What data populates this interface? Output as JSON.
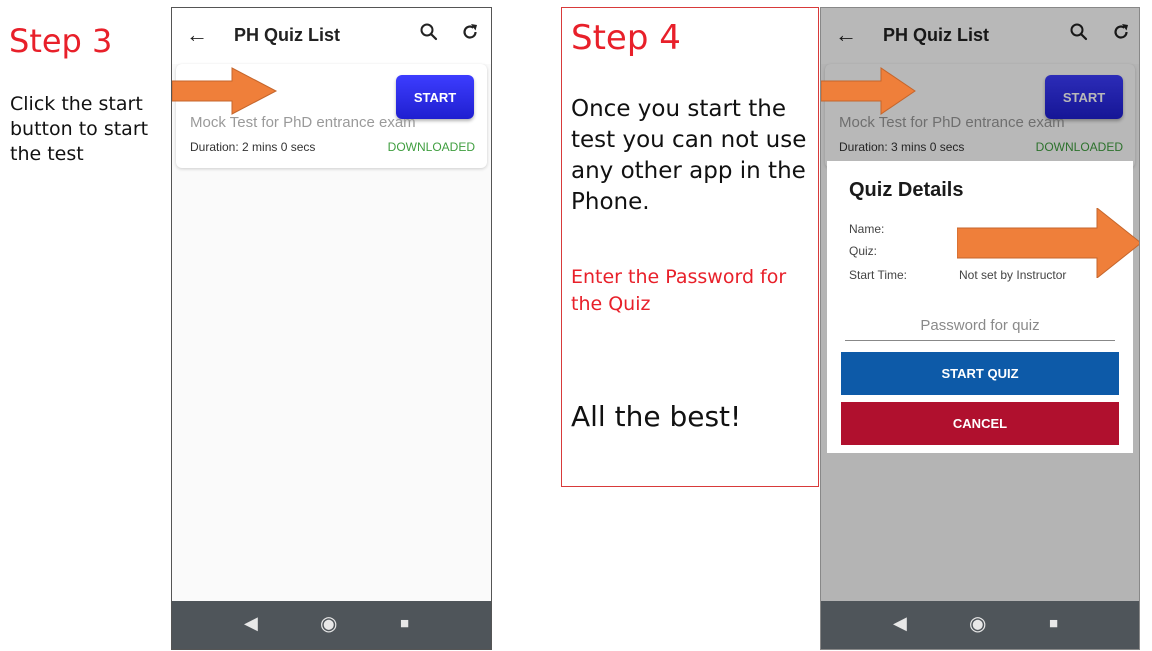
{
  "step3": {
    "title": "Step 3",
    "desc_line1": "Click the start",
    "desc_line2": "button to start",
    "desc_line3": "the test"
  },
  "step4": {
    "title": "Step 4",
    "desc_line1": "Once you start the",
    "desc_line2": "test you can not use",
    "desc_line3": "any other app in the",
    "desc_line4": "Phone.",
    "note_line1": "Enter the Password for",
    "note_line2": "the Quiz",
    "closing": "All the best!"
  },
  "phone1": {
    "appbar_title": "PH Quiz List",
    "back_icon": "←",
    "search_icon": "⌕",
    "refresh_icon": "↻",
    "start_label": "START",
    "quiz_name": "Mock Test for PhD entrance exam",
    "duration": "Duration: 2 mins 0 secs",
    "status": "DOWNLOADED"
  },
  "phone2": {
    "appbar_title": "PH Quiz List",
    "back_icon": "←",
    "search_icon": "⌕",
    "refresh_icon": "↻",
    "start_label": "START",
    "quiz_name": "Mock Test for PhD entrance exam",
    "duration": "Duration: 3 mins 0 secs",
    "status": "DOWNLOADED",
    "dialog": {
      "title": "Quiz Details",
      "name_label": "Name:",
      "quiz_label": "Quiz:",
      "start_time_label": "Start Time:",
      "start_time_value": "Not set by Instructor",
      "password_placeholder": "Password for quiz",
      "start_quiz_label": "START QUIZ",
      "cancel_label": "CANCEL"
    }
  },
  "navbar": {
    "back_glyph": "◀",
    "home_glyph": "◉",
    "recents_glyph": "■"
  },
  "colors": {
    "step_title": "#e8202a",
    "start_button": "#2626e8",
    "start_quiz_button": "#0d5aa8",
    "cancel_button": "#b0102e",
    "downloaded": "#3f9e3f",
    "arrow": "#ef7f3a",
    "navbar": "#4f555a"
  }
}
